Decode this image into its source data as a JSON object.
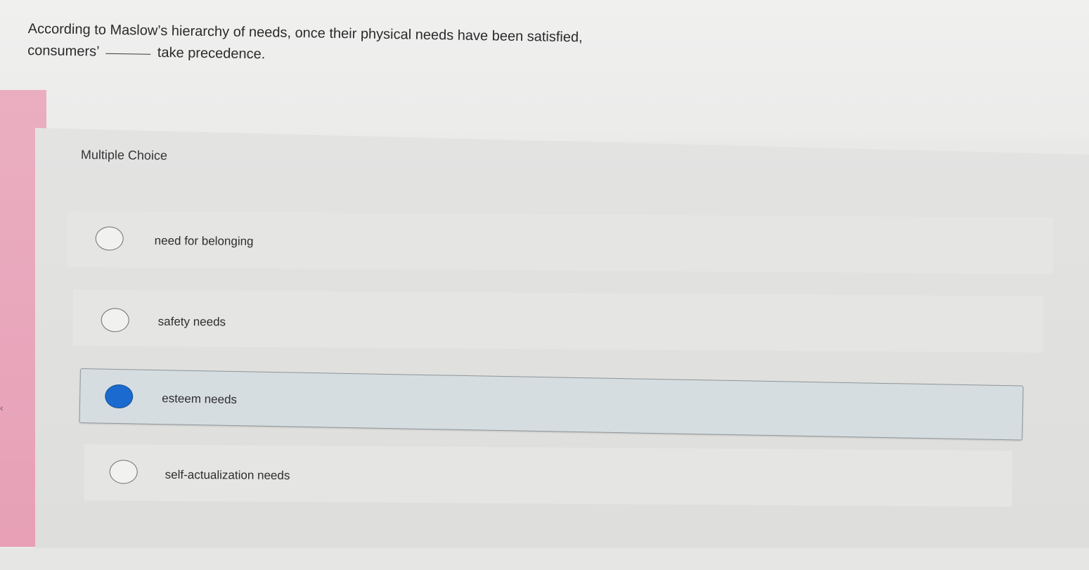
{
  "question": {
    "line1": "According to Maslow’s hierarchy of needs, once their physical needs have been satisfied,",
    "line2_before": "consumers’",
    "line2_after": "take precedence."
  },
  "question_type": "Multiple Choice",
  "options": [
    {
      "label": "need for belonging",
      "selected": false
    },
    {
      "label": "safety needs",
      "selected": false
    },
    {
      "label": "esteem needs",
      "selected": true
    },
    {
      "label": "self-actualization needs",
      "selected": false
    }
  ],
  "colors": {
    "accent_selected": "#1a6ad0",
    "side_strip": "#e9a7bc"
  }
}
